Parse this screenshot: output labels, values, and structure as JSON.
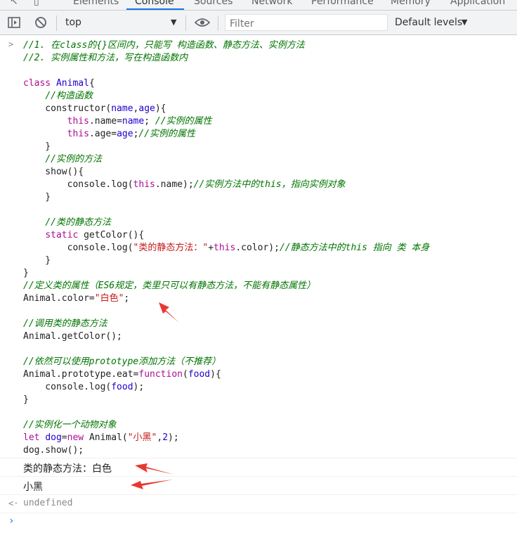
{
  "tabs": [
    "Elements",
    "Console",
    "Sources",
    "Network",
    "Performance",
    "Memory",
    "Application"
  ],
  "toolbar": {
    "context": "top",
    "filter_placeholder": "Filter",
    "levels": "Default levels"
  },
  "code_lines": [
    [
      {
        "t": "//1. 在class的{}区间内，只能写 构造函数、静态方法、实例方法",
        "c": "cm"
      }
    ],
    [
      {
        "t": "//2. 实例属性和方法，写在构造函数内",
        "c": "cm"
      }
    ],
    [],
    [
      {
        "t": "class ",
        "c": "kw"
      },
      {
        "t": "Animal",
        "c": "cls"
      },
      {
        "t": "{",
        "c": ""
      }
    ],
    [
      {
        "t": "    ",
        "c": ""
      },
      {
        "t": "//构造函数",
        "c": "cm"
      }
    ],
    [
      {
        "t": "    constructor(",
        "c": ""
      },
      {
        "t": "name",
        "c": "prop"
      },
      {
        "t": ",",
        "c": ""
      },
      {
        "t": "age",
        "c": "prop"
      },
      {
        "t": "){",
        "c": ""
      }
    ],
    [
      {
        "t": "        ",
        "c": ""
      },
      {
        "t": "this",
        "c": "kw"
      },
      {
        "t": ".name=",
        "c": ""
      },
      {
        "t": "name",
        "c": "prop"
      },
      {
        "t": "; ",
        "c": ""
      },
      {
        "t": "//实例的属性",
        "c": "cm"
      }
    ],
    [
      {
        "t": "        ",
        "c": ""
      },
      {
        "t": "this",
        "c": "kw"
      },
      {
        "t": ".age=",
        "c": ""
      },
      {
        "t": "age",
        "c": "prop"
      },
      {
        "t": ";",
        "c": ""
      },
      {
        "t": "//实例的属性",
        "c": "cm"
      }
    ],
    [
      {
        "t": "    }",
        "c": ""
      }
    ],
    [
      {
        "t": "    ",
        "c": ""
      },
      {
        "t": "//实例的方法",
        "c": "cm"
      }
    ],
    [
      {
        "t": "    show(){",
        "c": ""
      }
    ],
    [
      {
        "t": "        console.log(",
        "c": ""
      },
      {
        "t": "this",
        "c": "kw"
      },
      {
        "t": ".name);",
        "c": ""
      },
      {
        "t": "//实例方法中的this，指向实例对象",
        "c": "cm"
      }
    ],
    [
      {
        "t": "    }",
        "c": ""
      }
    ],
    [],
    [
      {
        "t": "    ",
        "c": ""
      },
      {
        "t": "//类的静态方法",
        "c": "cm"
      }
    ],
    [
      {
        "t": "    ",
        "c": ""
      },
      {
        "t": "static ",
        "c": "kw"
      },
      {
        "t": "getColor(){",
        "c": ""
      }
    ],
    [
      {
        "t": "        console.log(",
        "c": ""
      },
      {
        "t": "\"类的静态方法：\"",
        "c": "str"
      },
      {
        "t": "+",
        "c": ""
      },
      {
        "t": "this",
        "c": "kw"
      },
      {
        "t": ".color);",
        "c": ""
      },
      {
        "t": "//静态方法中的this 指向 类 本身",
        "c": "cm"
      }
    ],
    [
      {
        "t": "    }",
        "c": ""
      }
    ],
    [
      {
        "t": "}",
        "c": ""
      }
    ],
    [
      {
        "t": "//定义类的属性（ES6规定，类里只可以有静态方法，不能有静态属性）",
        "c": "cm"
      }
    ],
    [
      {
        "t": "Animal.color=",
        "c": ""
      },
      {
        "t": "\"白色\"",
        "c": "str"
      },
      {
        "t": ";",
        "c": ""
      }
    ],
    [],
    [
      {
        "t": "//调用类的静态方法",
        "c": "cm"
      }
    ],
    [
      {
        "t": "Animal.getColor();",
        "c": ""
      }
    ],
    [],
    [
      {
        "t": "//依然可以使用prototype添加方法（不推荐）",
        "c": "cm"
      }
    ],
    [
      {
        "t": "Animal.prototype.eat=",
        "c": ""
      },
      {
        "t": "function",
        "c": "kw"
      },
      {
        "t": "(",
        "c": ""
      },
      {
        "t": "food",
        "c": "prop"
      },
      {
        "t": "){",
        "c": ""
      }
    ],
    [
      {
        "t": "    console.log(",
        "c": ""
      },
      {
        "t": "food",
        "c": "prop"
      },
      {
        "t": ");",
        "c": ""
      }
    ],
    [
      {
        "t": "}",
        "c": ""
      }
    ],
    [],
    [
      {
        "t": "//实例化一个动物对象",
        "c": "cm"
      }
    ],
    [
      {
        "t": "let ",
        "c": "kw"
      },
      {
        "t": "dog",
        "c": "prop"
      },
      {
        "t": "=",
        "c": ""
      },
      {
        "t": "new ",
        "c": "kw"
      },
      {
        "t": "Animal(",
        "c": ""
      },
      {
        "t": "\"小黑\"",
        "c": "str"
      },
      {
        "t": ",",
        "c": ""
      },
      {
        "t": "2",
        "c": "num"
      },
      {
        "t": ");",
        "c": ""
      }
    ],
    [
      {
        "t": "dog.show();",
        "c": ""
      }
    ]
  ],
  "output": {
    "line1": "类的静态方法：白色",
    "line2": "小黑",
    "result": "undefined"
  },
  "colors": {
    "arrow": "#e8382f",
    "accent": "#1a73e8"
  }
}
